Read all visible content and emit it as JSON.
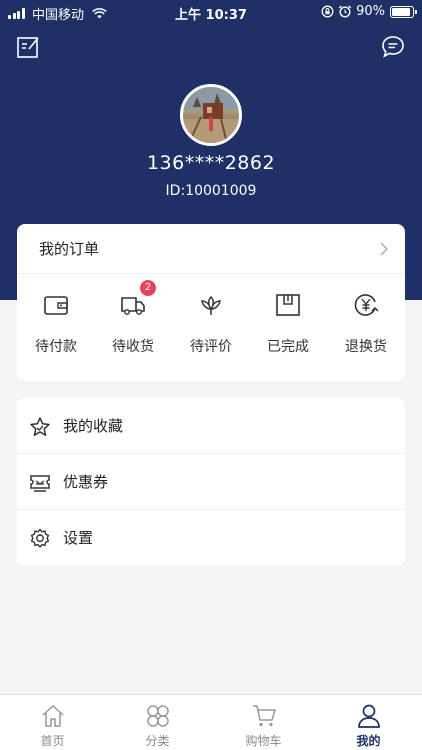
{
  "status_bar": {
    "carrier": "中国移动",
    "time": "上午 10:37",
    "battery": "90%",
    "battery_level": 0.9
  },
  "header": {
    "left_icon": "edit-note-icon",
    "right_icon": "message-bubble-icon",
    "phone": "136****2862",
    "user_id": "ID:10001009"
  },
  "orders": {
    "title": "我的订单",
    "items": [
      {
        "label": "待付款",
        "icon": "wallet-icon"
      },
      {
        "label": "待收货",
        "icon": "truck-icon",
        "badge": "2"
      },
      {
        "label": "待评价",
        "icon": "lotus-icon"
      },
      {
        "label": "已完成",
        "icon": "box-icon"
      },
      {
        "label": "退换货",
        "icon": "yuan-refund-icon"
      }
    ]
  },
  "menu": {
    "items": [
      {
        "label": "我的收藏",
        "icon": "star-icon"
      },
      {
        "label": "优惠券",
        "icon": "coupon-icon"
      },
      {
        "label": "设置",
        "icon": "gear-icon"
      }
    ]
  },
  "tabbar": {
    "items": [
      {
        "label": "首页",
        "icon": "home-icon"
      },
      {
        "label": "分类",
        "icon": "category-icon"
      },
      {
        "label": "购物车",
        "icon": "cart-icon"
      },
      {
        "label": "我的",
        "icon": "person-icon",
        "active": true
      }
    ]
  },
  "colors": {
    "header_bg": "#1e3066",
    "badge": "#e8435d",
    "active_tab": "#1e3066"
  }
}
